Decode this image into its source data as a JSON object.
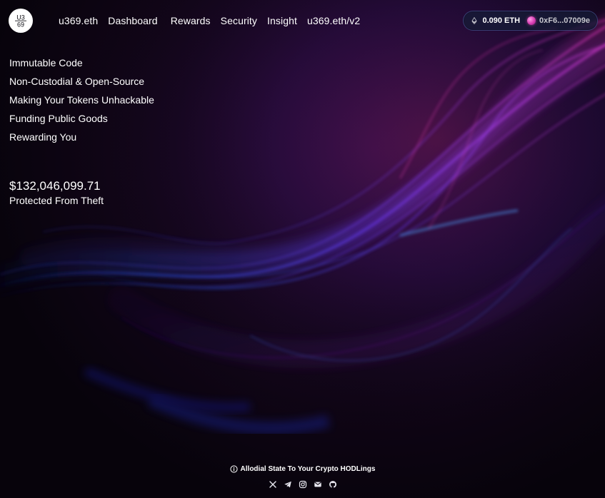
{
  "brand": {
    "logo_text_top": "U3",
    "logo_text_bottom": "69"
  },
  "nav": {
    "items": [
      {
        "label": "u369.eth"
      },
      {
        "label": "Dashboard"
      },
      {
        "label": "Rewards"
      },
      {
        "label": "Security"
      },
      {
        "label": "Insight"
      },
      {
        "label": "u369.eth/v2"
      }
    ]
  },
  "wallet": {
    "balance": "0.090 ETH",
    "address": "0xF6...07009e"
  },
  "taglines": [
    "Immutable Code",
    "Non-Custodial & Open-Source",
    "Making Your Tokens Unhackable",
    "Funding Public Goods",
    "Rewarding You"
  ],
  "stats": {
    "protected_amount": "$132,046,099.71",
    "protected_label": "Protected From Theft"
  },
  "footer": {
    "note": "Allodial State To Your Crypto HODLings",
    "socials": [
      "x-icon",
      "telegram-icon",
      "instagram-icon",
      "mail-icon",
      "github-icon"
    ]
  },
  "theme": {
    "accent_magenta": "#e43bd6",
    "accent_purple": "#8a3dff",
    "accent_blue": "#3d7dff",
    "background": "#08030c"
  }
}
